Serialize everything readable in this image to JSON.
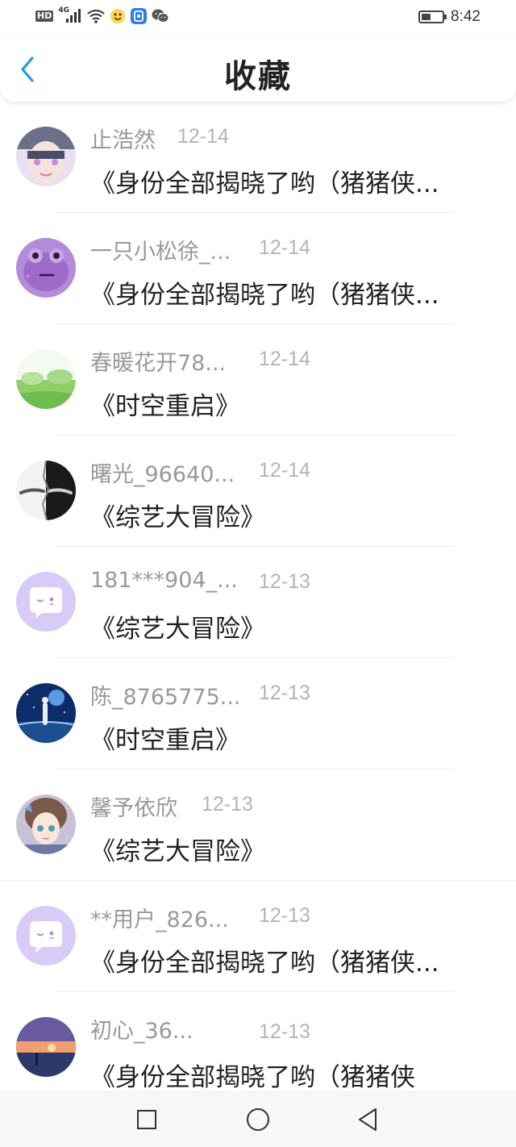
{
  "status_bar": {
    "hd": "HD",
    "network": "4G",
    "time": "8:42",
    "battery_level": 0.45,
    "icons": [
      "signal-icon",
      "wifi-icon",
      "app-notification-icon",
      "security-app-icon",
      "wechat-icon",
      "battery-icon"
    ]
  },
  "header": {
    "title": "收藏",
    "back_icon": "chevron-left-icon",
    "accent": "#1e9bea"
  },
  "items": [
    {
      "user": "止浩然",
      "date": "12-14",
      "title": "《身份全部揭晓了哟（猪猪侠..."
    },
    {
      "user": "一只小松徐_...",
      "date": "12-14",
      "title": "《身份全部揭晓了哟（猪猪侠..."
    },
    {
      "user": "春暖花开78...",
      "date": "12-14",
      "title": "《时空重启》"
    },
    {
      "user": "曙光_96640...",
      "date": "12-14",
      "title": "《综艺大冒险》"
    },
    {
      "user": "181***904_...",
      "date": "12-13",
      "title": "《综艺大冒险》"
    },
    {
      "user": "陈_8765775...",
      "date": "12-13",
      "title": "《时空重启》"
    },
    {
      "user": "馨予依欣",
      "date": "12-13",
      "title": "《综艺大冒险》"
    },
    {
      "user": "**用户_826...",
      "date": "12-13",
      "title": "《身份全部揭晓了哟（猪猪侠..."
    },
    {
      "user": "初心_36...",
      "date": "12-13",
      "title": "《身份全部揭晓了哟（猪猪侠"
    }
  ],
  "nav_bar": {
    "icons": [
      "recent-apps-icon",
      "home-icon",
      "back-triangle-icon"
    ]
  }
}
